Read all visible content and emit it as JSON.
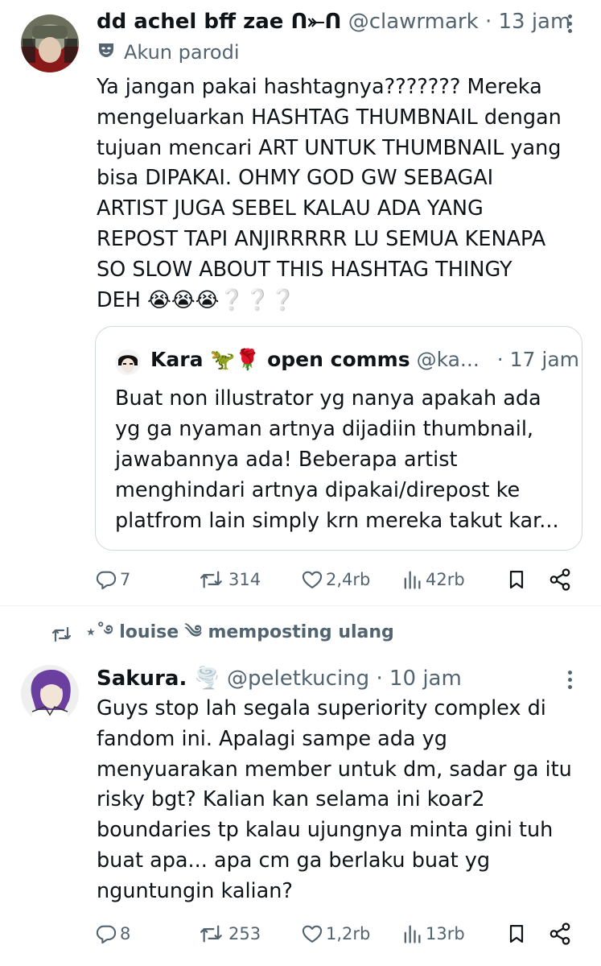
{
  "tweet1": {
    "display_name": "dd achel bff zae ᑎ⤜ᑎ",
    "handle": "@clawrmark",
    "separator": "·",
    "time": "13 jam",
    "parody_label": "Akun parodi",
    "text": "Ya jangan pakai hashtagnya??????? Mereka\nmengeluarkan HASHTAG THUMBNAIL dengan\ntujuan mencari ART UNTUK THUMBNAIL yang\nbisa DIPAKAI. OHMY GOD GW SEBAGAI\nARTIST JUGA SEBEL KALAU ADA YANG\nREPOST TAPI ANJIRRRRR LU SEMUA KENAPA\nSO SLOW ABOUT THIS HASHTAG THINGY\nDEH 😭😭😭❔❔❔",
    "quote": {
      "display_name": "Kara 🦖🌹 open comms",
      "handle": "@ka...",
      "separator": "·",
      "time": "17 jam",
      "text": "Buat non illustrator yg nanya apakah ada\nyg ga nyaman artnya dijadiin thumbnail,\njawabannya ada! Beberapa artist\nmenghindari artnya dipakai/direpost ke\nplatfrom lain simply krn mereka takut kar..."
    },
    "actions": {
      "replies": "7",
      "reposts": "314",
      "likes": "2,4rb",
      "views": "42rb"
    }
  },
  "repost_banner": {
    "text": "⋆˚࿔ louise ༄ memposting ulang"
  },
  "tweet2": {
    "display_name": "Sakura. 🌪️",
    "handle": "@peletkucing",
    "separator": "·",
    "time": "10 jam",
    "text": "Guys stop lah segala superiority complex di\nfandom ini. Apalagi sampe ada yg\nmenyuarakan member untuk dm, sadar ga itu\nrisky bgt? Kalian kan selama ini koar2\nboundaries tp kalau ujungnya minta gini tuh\nbuat apa... apa cm ga berlaku buat yg\nnguntungin kalian?",
    "actions": {
      "replies": "8",
      "reposts": "253",
      "likes": "1,2rb",
      "views": "13rb"
    }
  },
  "colors": {
    "text": "#0f1419",
    "secondary": "#536471",
    "border": "#cfd9de"
  }
}
